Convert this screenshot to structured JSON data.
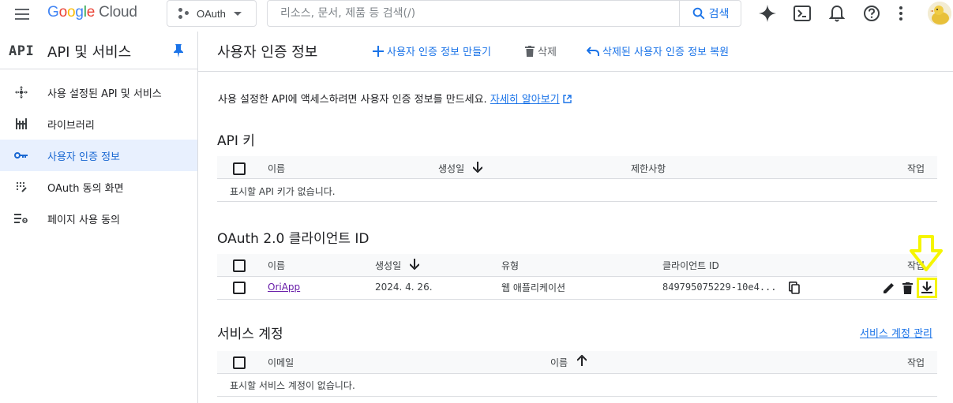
{
  "header": {
    "logo_google": "Google",
    "logo_cloud": "Cloud",
    "project_label": "OAuth",
    "search_placeholder": "리소스, 문서, 제품 등 검색(/)",
    "search_button": "검색",
    "icons": [
      "gemini-sparkle-icon",
      "cloud-shell-icon",
      "notifications-icon",
      "help-icon",
      "more-vert-icon"
    ]
  },
  "sidebar": {
    "api_mark": "API",
    "title": "API 및 서비스",
    "items": [
      {
        "label": "사용 설정된 API 및 서비스",
        "icon": "enabled-apis-icon",
        "active": false
      },
      {
        "label": "라이브러리",
        "icon": "library-icon",
        "active": true
      },
      {
        "label": "사용자 인증 정보",
        "icon": "key-icon",
        "active": true
      },
      {
        "label": "OAuth 동의 화면",
        "icon": "oauth-consent-icon",
        "active": false
      },
      {
        "label": "페이지 사용 동의",
        "icon": "page-usage-icon",
        "active": false
      }
    ]
  },
  "main": {
    "page_title": "사용자 인증 정보",
    "actions": {
      "create": "사용자 인증 정보 만들기",
      "delete": "삭제",
      "restore": "삭제된 사용자 인증 정보 복원"
    },
    "intro_text": "사용 설정한 API에 액세스하려면 사용자 인증 정보를 만드세요.",
    "intro_link": "자세히 알아보기",
    "api_keys": {
      "title": "API 키",
      "columns": [
        "이름",
        "생성일",
        "제한사항",
        "작업"
      ],
      "empty_text": "표시할 API 키가 없습니다."
    },
    "oauth": {
      "title": "OAuth 2.0 클라이언트 ID",
      "columns": [
        "이름",
        "생성일",
        "유형",
        "클라이언트 ID",
        "작업"
      ],
      "rows": [
        {
          "name": "OriApp",
          "created": "2024. 4. 26.",
          "type": "웹 애플리케이션",
          "client_id": "849795075229-10e4..."
        }
      ]
    },
    "service_accounts": {
      "title": "서비스 계정",
      "manage_link": "서비스 계정 관리",
      "columns": [
        "이메일",
        "이름",
        "작업"
      ],
      "empty_text": "표시할 서비스 계정이 없습니다."
    }
  },
  "colors": {
    "accent": "#1a73e8",
    "active_bg": "#e8f0fe",
    "highlight": "#f5f500",
    "visited_link": "#681da8"
  }
}
